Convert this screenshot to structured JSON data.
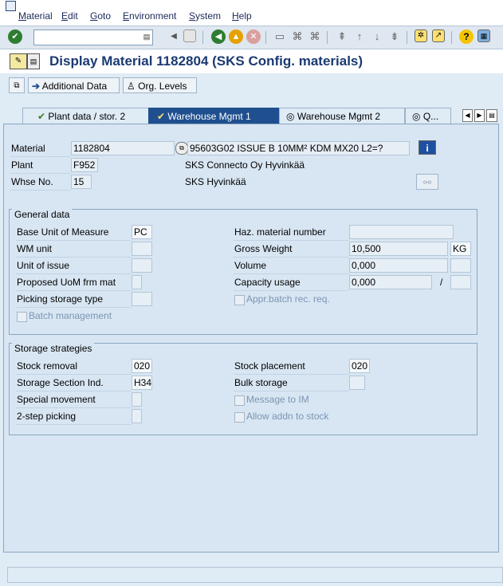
{
  "menubar": {
    "items": [
      "Material",
      "Edit",
      "Goto",
      "Environment",
      "System",
      "Help"
    ]
  },
  "toolbar": {
    "command_value": "",
    "icons": [
      "enter-icon",
      "back-icon",
      "exit-icon",
      "cancel-icon",
      "print-icon",
      "find-icon",
      "find-next-icon",
      "first-page-icon",
      "prev-page-icon",
      "next-page-icon",
      "last-page-icon",
      "new-session-icon",
      "shortcut-icon",
      "help-icon",
      "customize-icon",
      "save-icon"
    ]
  },
  "title": {
    "text": "Display Material 1182804 (SKS Config. materials)"
  },
  "appbar": {
    "additional_data": "Additional Data",
    "org_levels": "Org. Levels"
  },
  "tabs": [
    {
      "label": "Plant data / stor. 2",
      "active": false
    },
    {
      "label": "Warehouse Mgmt 1",
      "active": true
    },
    {
      "label": "Warehouse Mgmt 2",
      "active": false
    },
    {
      "label": "Q...",
      "active": false
    }
  ],
  "header": {
    "material_label": "Material",
    "material_value": "1182804",
    "material_desc": "95603G02 ISSUE B 10MM² KDM MX20 L2=?",
    "plant_label": "Plant",
    "plant_value": "F952",
    "plant_desc": "SKS Connecto Oy Hyvinkää",
    "whse_label": "Whse No.",
    "whse_value": "15",
    "whse_desc": "SKS Hyvinkää"
  },
  "general": {
    "title": "General data",
    "base_uom_label": "Base Unit of Measure",
    "base_uom_value": "PC",
    "wm_unit_label": "WM unit",
    "unit_issue_label": "Unit of issue",
    "proposed_uom_label": "Proposed UoM frm mat",
    "picking_type_label": "Picking storage type",
    "batch_mgmt_label": "Batch management",
    "haz_label": "Haz. material number",
    "gross_weight_label": "Gross Weight",
    "gross_weight_value": "10,500",
    "gross_weight_unit": "KG",
    "volume_label": "Volume",
    "volume_value": "0,000",
    "capacity_label": "Capacity usage",
    "capacity_value": "0,000",
    "capacity_slash": "/",
    "appr_batch_label": "Appr.batch rec. req."
  },
  "storage": {
    "title": "Storage strategies",
    "stock_removal_label": "Stock removal",
    "stock_removal_value": "020",
    "section_label": "Storage Section Ind.",
    "section_value": "H34",
    "special_mov_label": "Special movement",
    "two_step_label": "2-step picking",
    "stock_placement_label": "Stock placement",
    "stock_placement_value": "020",
    "bulk_label": "Bulk storage",
    "msg_im_label": "Message to IM",
    "addn_stock_label": "Allow addn to stock"
  }
}
